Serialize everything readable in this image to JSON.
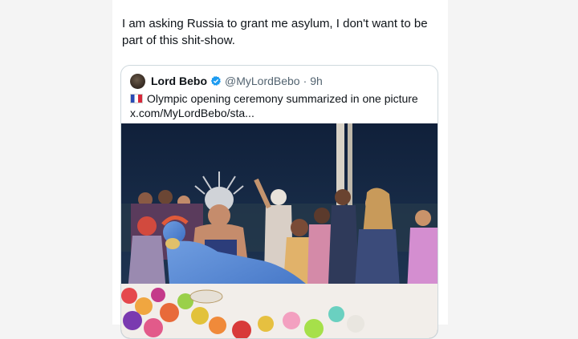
{
  "post": {
    "text_line1": "I am asking Russia to grant me asylum, I don't want to be",
    "text_line2": "part of this shit-show."
  },
  "quote": {
    "author_name": "Lord Bebo",
    "handle": "@MyLordBebo",
    "separator": "·",
    "time": "9h",
    "flag_icon": "french-flag-icon",
    "text": "Olympic opening ceremony summarized in one picture",
    "link": "x.com/MyLordBebo/sta...",
    "verified_color": "#1d9bf0"
  },
  "media": {
    "description_icon": "ceremony-photo"
  }
}
